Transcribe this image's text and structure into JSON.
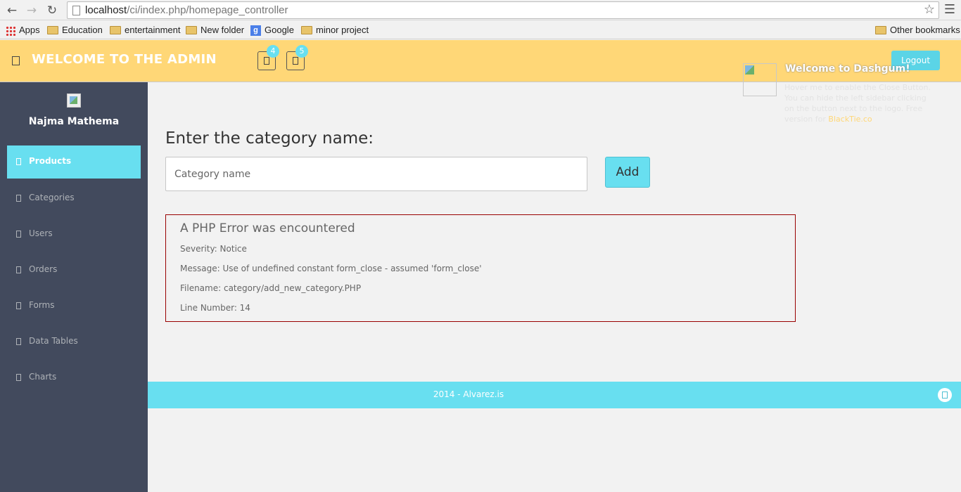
{
  "browser": {
    "url_host": "localhost",
    "url_path": "/ci/index.php/homepage_controller",
    "bookmarks": [
      "Apps",
      "Education",
      "entertainment",
      "New folder",
      "Google",
      "minor project"
    ],
    "other_bookmarks": "Other bookmarks"
  },
  "header": {
    "title": "WELCOME TO THE ADMIN",
    "notif_badges": [
      "4",
      "5"
    ],
    "logout_label": "Logout"
  },
  "sidebar": {
    "user_name": "Najma Mathema",
    "items": [
      "Products",
      "Categories",
      "Users",
      "Orders",
      "Forms",
      "Data Tables",
      "Charts"
    ],
    "active_item": "Products"
  },
  "main": {
    "heading": "Enter the category name:",
    "input_placeholder": "Category name",
    "add_label": "Add"
  },
  "error": {
    "title": "A PHP Error was encountered",
    "severity": "Severity: Notice",
    "message": "Message: Use of undefined constant form_close - assumed 'form_close'",
    "filename": "Filename: category/add_new_category.PHP",
    "line_number": "Line Number: 14"
  },
  "welcome": {
    "title": "Welcome to Dashgum!",
    "text_before_link": "Hover me to enable the Close Button. You can hide the left sidebar clicking on the button next to the logo. Free version for",
    "link": "BlackTie.co"
  },
  "footer": {
    "text": "2014 - Alvarez.is"
  },
  "colors": {
    "header_bg": "#ffd777",
    "accent": "#68dff0",
    "sidebar_bg": "#424a5d",
    "error_border": "#990000"
  }
}
